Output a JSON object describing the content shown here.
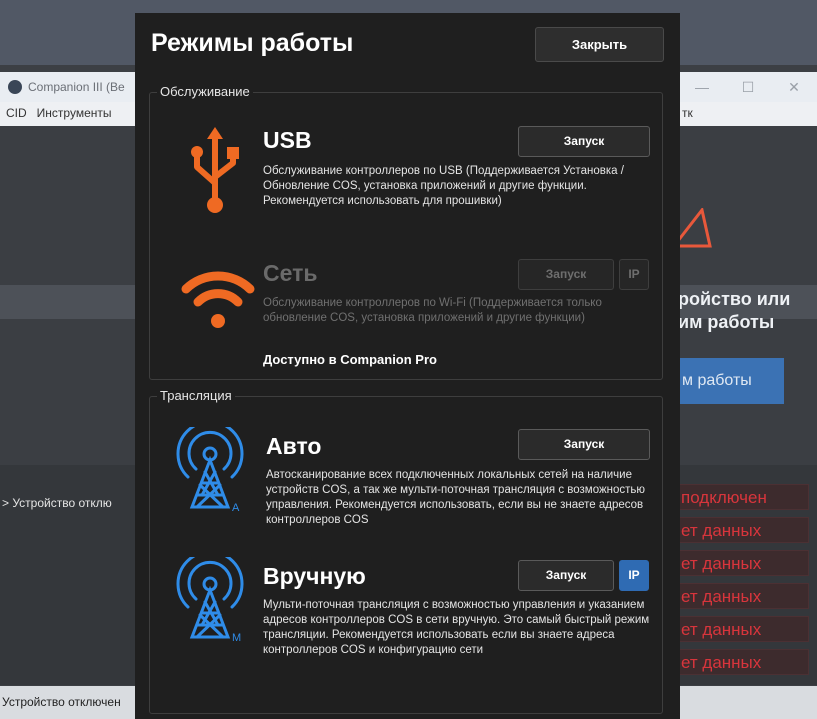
{
  "background": {
    "app_title": "Companion III (Be",
    "menu": [
      "CID",
      "Инструменты"
    ],
    "menu_right": "тк",
    "window_buttons": [
      "—",
      "☐",
      "✕"
    ],
    "message": [
      "ройство или",
      "им работы"
    ],
    "mode_button": "м работы",
    "status_left": "> Устройство отклю",
    "status_rows": [
      "подключен",
      "ет данных",
      "ет данных",
      "ет данных",
      "ет данных",
      "ет данных"
    ],
    "bottom_status": "Устройство отключен",
    "colors": {
      "accent_blue": "#3b72b4",
      "error_red": "#d8353c"
    }
  },
  "modal": {
    "title": "Режимы работы",
    "close_label": "Закрыть",
    "maintenance": {
      "legend": "Обслуживание",
      "usb": {
        "icon": "usb-icon",
        "title": "USB",
        "launch_label": "Запуск",
        "description": "Обслуживание контроллеров по USB (Поддерживается Установка / Обновление COS, установка приложений и другие функции. Рекомендуется использовать для прошивки)"
      },
      "network": {
        "icon": "wifi-icon",
        "title": "Сеть",
        "launch_label": "Запуск",
        "ip_label": "IP",
        "description": "Обслуживание контроллеров по Wi-Fi (Поддерживается только обновление COS, установка приложений и другие функции)",
        "pro_note": "Доступно в Companion Pro"
      }
    },
    "broadcast": {
      "legend": "Трансляция",
      "auto": {
        "icon": "antenna-auto-icon",
        "icon_letter": "A",
        "title": "Авто",
        "launch_label": "Запуск",
        "description": "Автосканирование всех подключенных локальных сетей на наличие устройств COS, а так же мульти-поточная трансляция с возможностью управления. Рекомендуется использовать, если вы не знаете адресов контроллеров COS"
      },
      "manual": {
        "icon": "antenna-manual-icon",
        "icon_letter": "M",
        "title": "Вручную",
        "launch_label": "Запуск",
        "ip_label": "IP",
        "description": "Мульти-поточная трансляция с возможностью управления и указанием адресов контроллеров COS в сети вручную. Это самый быстрый режим трансляции. Рекомендуется использовать если вы знаете адреса контроллеров COS и конфигурацию сети"
      }
    },
    "colors": {
      "usb_orange": "#ef6a23",
      "antenna_blue": "#2f8ce8",
      "ip_blue": "#2f6bb3"
    }
  }
}
